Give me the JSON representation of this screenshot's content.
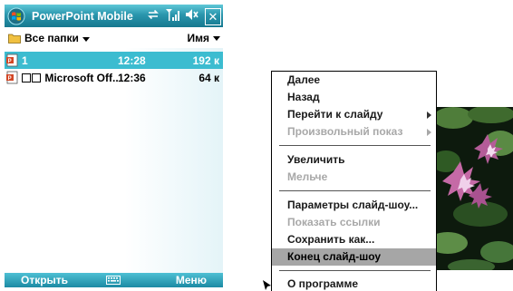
{
  "phone": {
    "title": "PowerPoint Mobile",
    "folder_label": "Все папки",
    "sort_label": "Имя",
    "files": [
      {
        "name": "1",
        "time": "12:28",
        "size": "192 к",
        "selected": true
      },
      {
        "name": "Microsoft Off...",
        "time": "12:36",
        "size": "64 к",
        "selected": false
      }
    ],
    "softkey_left": "Открыть",
    "softkey_right": "Меню",
    "colors": {
      "title_bar": "#2a96ad",
      "selected_row": "#3cbcd0"
    },
    "icons": [
      "windows-start-icon",
      "sync-icon",
      "signal-icon",
      "volume-icon",
      "close-icon",
      "folder-icon",
      "powerpoint-file-icon",
      "keyboard-icon"
    ]
  },
  "context_menu": {
    "items": [
      {
        "label": "Далее",
        "disabled": false
      },
      {
        "label": "Назад",
        "disabled": false
      },
      {
        "label": "Перейти к слайду",
        "disabled": false,
        "submenu": true
      },
      {
        "label": "Произвольный показ",
        "disabled": true,
        "submenu": true
      },
      {
        "label": "Увеличить",
        "disabled": false
      },
      {
        "label": "Мельче",
        "disabled": true
      },
      {
        "label": "Параметры слайд-шоу...",
        "disabled": false
      },
      {
        "label": "Показать ссылки",
        "disabled": true
      },
      {
        "label": "Сохранить как...",
        "disabled": false
      },
      {
        "label": "Конец слайд-шоу",
        "disabled": false,
        "highlighted": true
      },
      {
        "label": "О программе",
        "disabled": false
      }
    ],
    "colors": {
      "highlight": "#a6a6a6",
      "disabled_text": "#a8a8a8"
    }
  }
}
